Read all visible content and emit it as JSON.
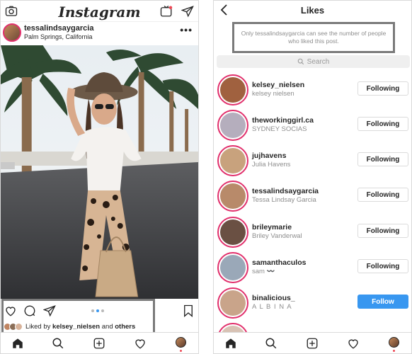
{
  "feed": {
    "logo": "Instagram",
    "post": {
      "username": "tessalindsaygarcia",
      "location": "Palm Springs, California",
      "more": "•••",
      "liked_by_prefix": "Liked by",
      "liked_by_user": "kelsey_nielsen",
      "liked_by_and": "and",
      "liked_by_others": "others"
    }
  },
  "likes_screen": {
    "title": "Likes",
    "notice": "Only tessalindsaygarcia can see the number of people who liked this post.",
    "search_placeholder": "Search",
    "users": [
      {
        "username": "kelsey_nielsen",
        "name": "kelsey nielsen",
        "button": "Following",
        "color": "#a0613f"
      },
      {
        "username": "theworkinggirl.ca",
        "name": "SYDNEY SOCIAS",
        "button": "Following",
        "color": "#b5aebd"
      },
      {
        "username": "jujhavens",
        "name": "Julia Havens",
        "button": "Following",
        "color": "#c8a27d"
      },
      {
        "username": "tessalindsaygarcia",
        "name": "Tessa Lindsay Garcia",
        "button": "Following",
        "color": "#b88a6a"
      },
      {
        "username": "brileymarie",
        "name": "Briley Vanderwal",
        "button": "Following",
        "color": "#6a5043"
      },
      {
        "username": "samanthaculos",
        "name": "sam 〰️",
        "button": "Following",
        "color": "#9aa8b8"
      },
      {
        "username": "binalicious_",
        "name": "A L B I N A",
        "button": "Follow",
        "color": "#c9a48a"
      }
    ]
  },
  "colors": {
    "accent_blue": "#3897f0",
    "notification_red": "#ed4956",
    "highlight_border": "#7a7a7a"
  }
}
